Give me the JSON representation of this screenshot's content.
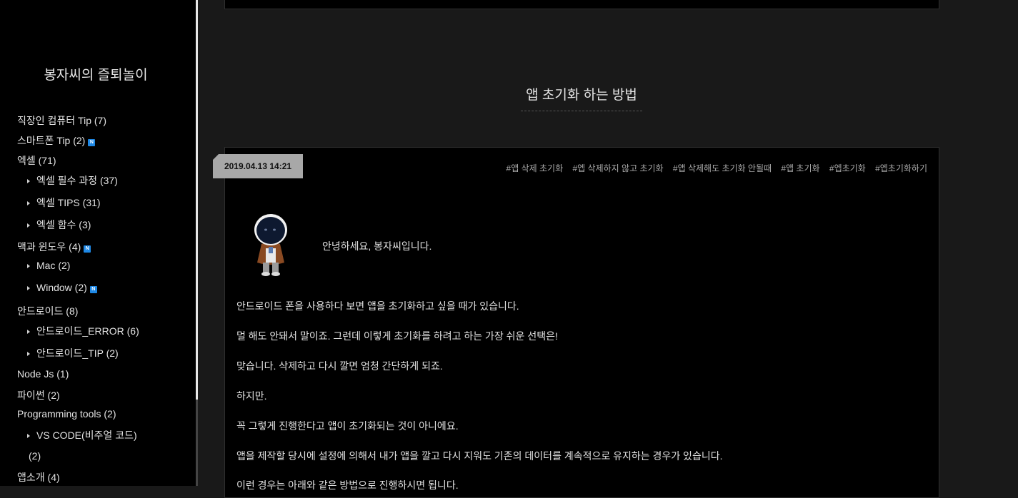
{
  "blog": {
    "title": "봉자씨의 즐퇴놀이"
  },
  "sidebar": {
    "categories": [
      {
        "label": "직장인 컴퓨터 Tip (7)",
        "new": false
      },
      {
        "label": "스마트폰 Tip (2)",
        "new": true
      },
      {
        "label": "엑셀 (71)",
        "new": false
      },
      {
        "label": "엑셀 필수 과정 (37)",
        "new": false
      },
      {
        "label": "엑셀 TIPS (31)",
        "new": false
      },
      {
        "label": "엑셀 함수 (3)",
        "new": false
      },
      {
        "label": "맥과 윈도우 (4)",
        "new": true
      },
      {
        "label": "Mac (2)",
        "new": false
      },
      {
        "label": "Window (2)",
        "new": true
      },
      {
        "label": "안드로이드 (8)",
        "new": false
      },
      {
        "label": "안드로이드_ERROR (6)",
        "new": false
      },
      {
        "label": "안드로이드_TIP (2)",
        "new": false
      },
      {
        "label": "Node Js (1)",
        "new": false
      },
      {
        "label": "파이썬 (2)",
        "new": false
      },
      {
        "label": "Programming tools (2)",
        "new": false
      },
      {
        "label": "VS CODE(비주얼 코드)",
        "new": false
      },
      {
        "label": "(2)",
        "new": false
      },
      {
        "label": "앱소개 (4)",
        "new": false
      }
    ],
    "new_badge": "N"
  },
  "post": {
    "title": "앱 초기화 하는 방법",
    "date": "2019.04.13 14:21",
    "tags": [
      "#앱 삭제 초기화",
      "#엡 삭제하지 않고 초기화",
      "#앱 삭제해도 초기화 안될때",
      "#앱 초기화",
      "#엡초기화",
      "#엡초기화하기"
    ],
    "greeting": "안녕하세요, 봉자씨입니다.",
    "paragraphs": [
      "안드로이드 폰을 사용하다 보면 앱을 초기화하고 싶을 때가 있습니다.",
      "멀 해도 안돼서 말이죠. 그런데 이렇게 초기화를 하려고 하는 가장 쉬운 선택은!",
      "맞습니다. 삭제하고 다시 깔면 엄청 간단하게 되죠.",
      "하지만.",
      "꼭 그렇게 진행한다고 앱이 초기화되는 것이 아니에요.",
      "앱을 제작할 당시에 설정에 의해서 내가 앱을 깔고 다시 지워도 기존의 데이터를 계속적으로 유지하는 경우가 있습니다.",
      "이런 경우는 아래와 같은 방법으로 진행하시면 됩니다."
    ]
  },
  "colors": {
    "badge": "#1e88e5",
    "date_tag": "#a8a8a8",
    "background": "#191919"
  }
}
